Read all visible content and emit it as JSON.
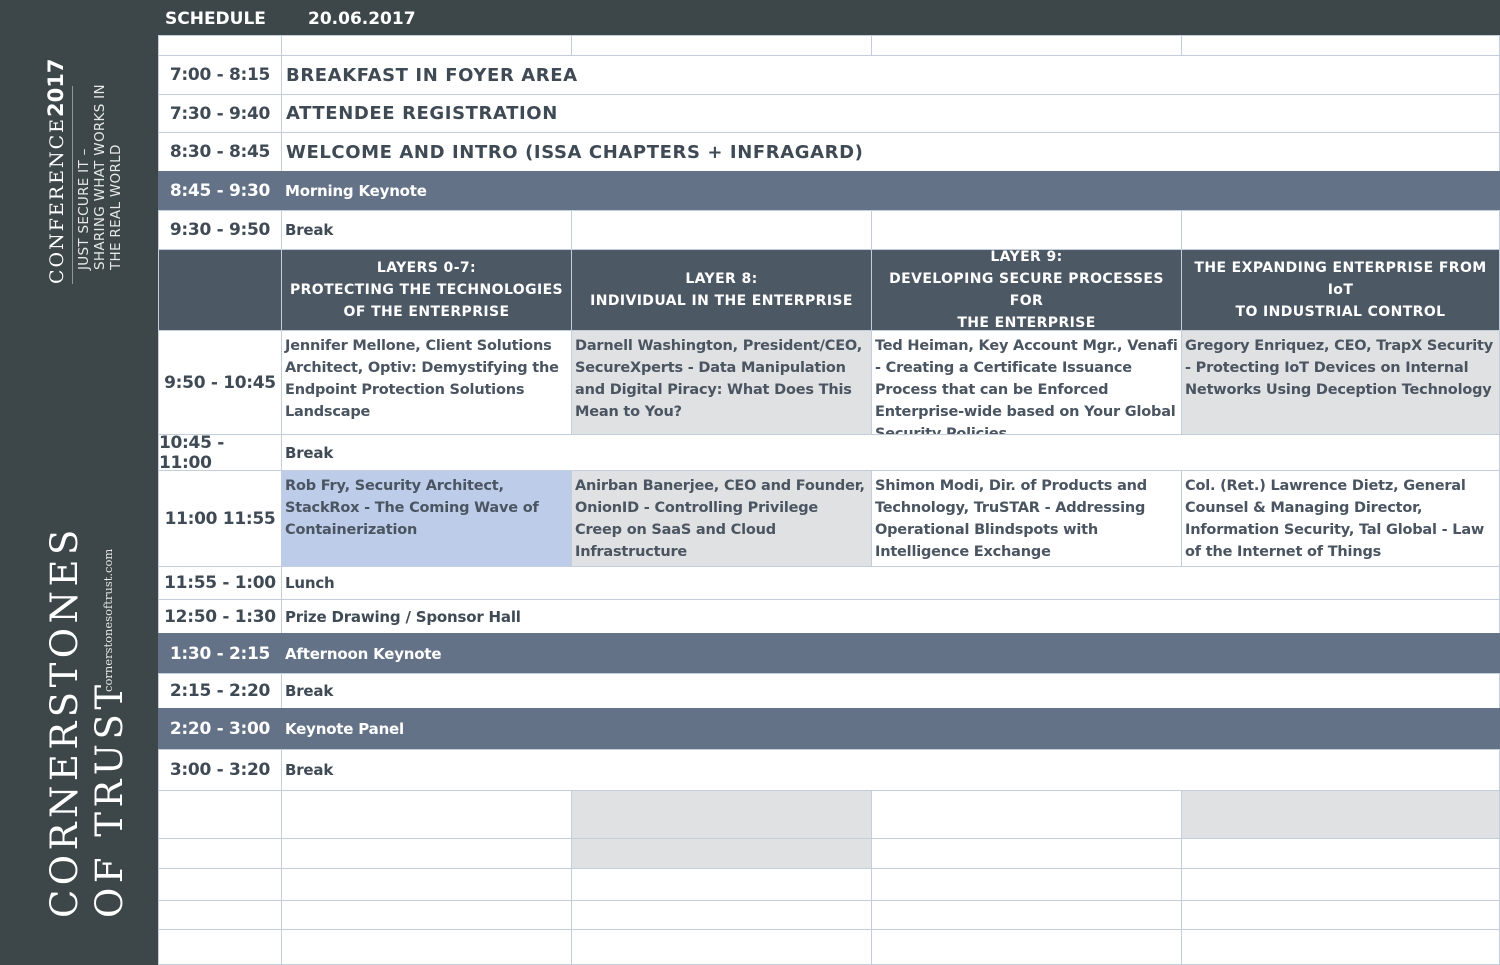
{
  "sidebar": {
    "conference_label": "CONFERENCE",
    "conference_year": "2017",
    "tagline_line1": "JUST SECURE IT –",
    "tagline_line2": "SHARING WHAT WORKS IN",
    "tagline_line3": "THE REAL WORLD",
    "brand_line1": "CORNERSTONES",
    "brand_line2": "OF TRUST",
    "website": "cornerstonesoftrust.com"
  },
  "header": {
    "label": "SCHEDULE",
    "date": "20.06.2017"
  },
  "rows": {
    "r1_time": "7:00 - 8:15",
    "r1_title": "BREAKFAST IN FOYER AREA",
    "r2_time": "7:30 - 9:40",
    "r2_title": "ATTENDEE REGISTRATION",
    "r3_time": "8:30 - 8:45",
    "r3_title": "WELCOME AND INTRO (ISSA CHAPTERS + INFRAGARD)",
    "r4_time": "8:45 - 9:30",
    "r4_title": "Morning Keynote",
    "r5_time": "9:30 - 9:50",
    "r5_title": "Break",
    "r7_time": "9:50 - 10:45",
    "r8_time": "10:45 - 11:00",
    "r8_title": "Break",
    "r9_time": "11:00 11:55",
    "r10_time": "11:55 - 1:00",
    "r10_title": "Lunch",
    "r11_time": "12:50 - 1:30",
    "r11_title": "Prize Drawing / Sponsor Hall",
    "r12_time": "1:30 - 2:15",
    "r12_title": "Afternoon Keynote",
    "r13_time": "2:15 - 2:20",
    "r13_title": "Break",
    "r14_time": "2:20 - 3:00",
    "r14_title": "Keynote Panel",
    "r15_time": "3:00 - 3:20",
    "r15_title": "Break"
  },
  "tracks": {
    "t1_l1": "LAYERS 0-7:",
    "t1_l2": "PROTECTING THE TECHNOLOGIES",
    "t1_l3": "OF THE ENTERPRISE",
    "t2_l1": "LAYER 8:",
    "t2_l2": "INDIVIDUAL IN THE ENTERPRISE",
    "t3_l1": "LAYER 9:",
    "t3_l2": "DEVELOPING SECURE PROCESSES FOR",
    "t3_l3": "THE ENTERPRISE",
    "t4_l1": "THE EXPANDING ENTERPRISE FROM IoT",
    "t4_l2": "TO INDUSTRIAL CONTROL"
  },
  "sessions": {
    "s1_1": "Jennifer Mellone, Client Solutions Architect, Optiv:  Demystifying the Endpoint Protection Solutions Landscape",
    "s1_2": "Darnell Washington, President/CEO, SecureXperts - Data Manipulation and Digital Piracy:  What Does This Mean to You?",
    "s1_3": "Ted Heiman, Key Account Mgr., Venafi - Creating a Certificate Issuance Process that can be Enforced Enterprise-wide based on Your Global Security Policies",
    "s1_4": "Gregory Enriquez, CEO, TrapX Security - Protecting IoT Devices on Internal Networks Using Deception Technology",
    "s2_1": "Rob Fry, Security Architect, StackRox - The Coming Wave of Containerization",
    "s2_2": "Anirban Banerjee, CEO and Founder, OnionID - Controlling Privilege Creep on SaaS and Cloud Infrastructure",
    "s2_3": "Shimon Modi, Dir. of Products and Technology, TruSTAR - Addressing Operational Blindspots with Intelligence Exchange",
    "s2_4": "Col. (Ret.) Lawrence Dietz, General Counsel & Managing Director, Information Security, Tal Global - Law of the Internet of Things"
  },
  "colors": {
    "sidebar": "#3d4749",
    "header_bar": "#3d4749",
    "keynote_band": "#637286",
    "track_header": "#4d5865",
    "grey_cell": "#e0e1e3",
    "highlight_cell": "#bdcde9",
    "border": "#c3cedc"
  }
}
